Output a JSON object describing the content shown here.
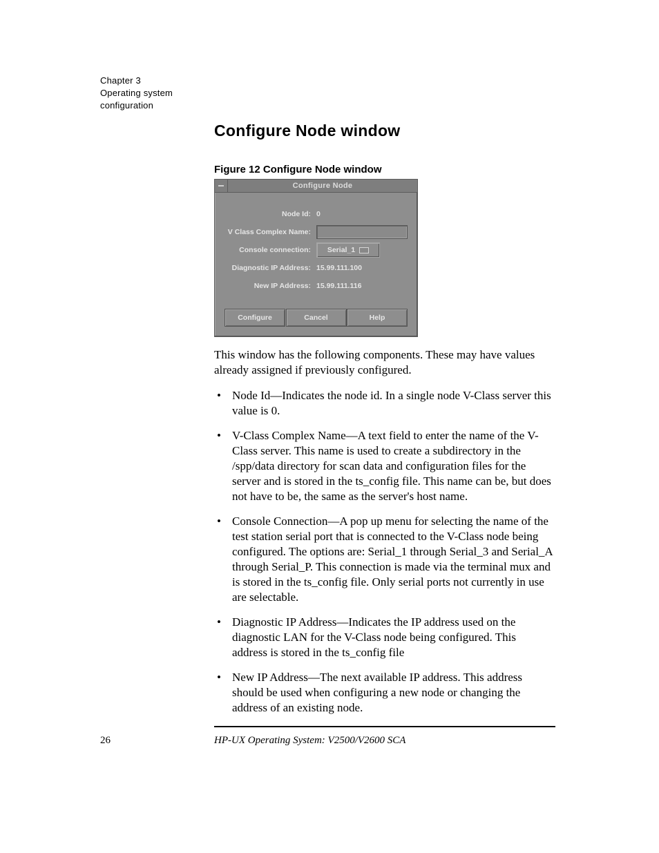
{
  "page": {
    "chapter_marker_line1": "Chapter 3",
    "chapter_marker_line2": "Operating system",
    "chapter_marker_line3": "configuration",
    "section_heading": "Configure Node window",
    "figure_caption": "Figure 12  Configure Node window",
    "explain_after": "This window has the following components. These may have values already assigned if previously configured.",
    "bullets": [
      "Node Id—Indicates the node id. In a single node V-Class server this value is 0.",
      "V-Class Complex Name—A text field to enter the name of the V-Class server. This name is used to create a subdirectory in the /spp/data directory for scan data and configuration files for the server and is stored in the ts_config file. This name can be, but does not have to be, the same as the server's host name.",
      "Console Connection—A pop up menu for selecting the name of the test station serial port that is connected to the V-Class node being configured. The options are: Serial_1 through Serial_3 and Serial_A through Serial_P. This connection is made via the terminal mux and is stored in the ts_config file. Only serial ports not currently in use are selectable.",
      "Diagnostic IP Address—Indicates the IP address used on the diagnostic LAN for the V-Class node being configured. This address is stored in the ts_config file",
      "New IP Address—The next available IP address. This address should be used when configuring a new node or changing the address of an existing node."
    ],
    "page_number": "26",
    "book_title": "HP-UX Operating System: V2500/V2600 SCA"
  },
  "dialog": {
    "title": "Configure Node",
    "rows": {
      "node_id_label": "Node Id:",
      "node_id_value": "0",
      "complex_name_label": "V Class Complex Name:",
      "complex_name_value": "",
      "console_conn_label": "Console connection:",
      "console_conn_value": "Serial_1",
      "diag_ip_label": "Diagnostic IP Address:",
      "diag_ip_value": "15.99.111.100",
      "new_ip_label": "New IP Address:",
      "new_ip_value": "15.99.111.116"
    },
    "buttons": {
      "configure": "Configure",
      "cancel": "Cancel",
      "help": "Help"
    }
  }
}
